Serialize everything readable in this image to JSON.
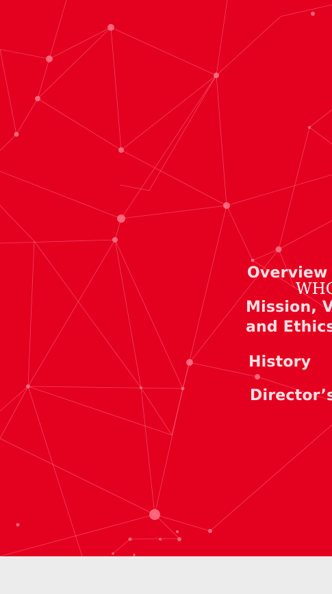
{
  "hero": {
    "background_color": "#e4001f",
    "pattern": "network-lines"
  },
  "brand": {
    "text": "WHO"
  },
  "nav": {
    "overview": "Overview",
    "mission_line1": "Mission, Va",
    "mission_line2": "and Ethics",
    "history": "History",
    "director": "Director’s"
  },
  "footer": {
    "background_color": "#ececec"
  }
}
